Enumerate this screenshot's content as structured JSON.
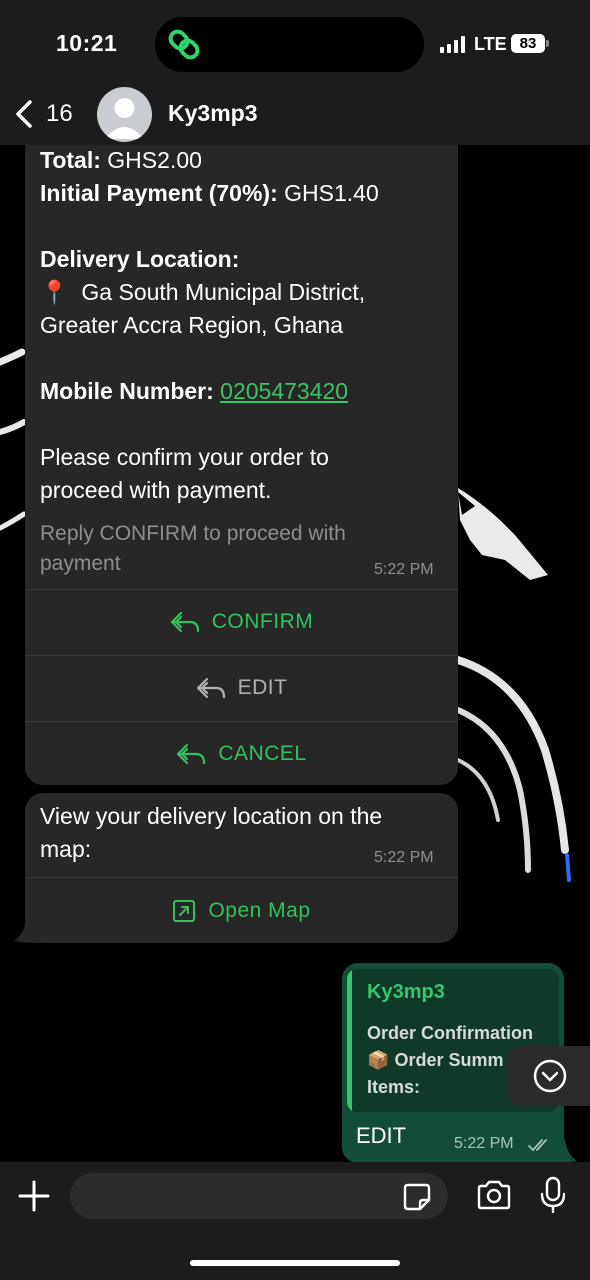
{
  "status": {
    "time": "10:21",
    "network": "LTE",
    "battery": "83"
  },
  "header": {
    "back_count": "16",
    "contact_name": "Ky3mp3"
  },
  "order_message": {
    "total_label": "Total:",
    "total_value": "GHS2.00",
    "initial_label": "Initial Payment (70%):",
    "initial_value": "GHS1.40",
    "delivery_label": "Delivery Location:",
    "pin": "📍",
    "location_line1": "Ga South Municipal District,",
    "location_line2": "Greater Accra Region, Ghana",
    "mobile_label": "Mobile Number:",
    "mobile_value": "0205473420",
    "confirm_line1": "Please confirm your order to",
    "confirm_line2": "proceed with payment.",
    "footer_line1": "Reply CONFIRM to proceed with",
    "footer_line2": "payment",
    "timestamp": "5:22 PM",
    "actions": [
      {
        "label": "CONFIRM",
        "color": "#33c05f"
      },
      {
        "label": "EDIT",
        "color": "#b0b1b0"
      },
      {
        "label": "CANCEL",
        "color": "#33c05f"
      }
    ]
  },
  "map_message": {
    "line1": "View your delivery location on the",
    "line2": "map:",
    "timestamp": "5:22 PM",
    "button_label": "Open Map"
  },
  "outgoing": {
    "quote_author": "Ky3mp3",
    "quote_line1": "Order Confirmation",
    "quote_emoji": "📦",
    "quote_line2": "Order Summ",
    "quote_line3": "Items:",
    "text": "EDIT",
    "timestamp": "5:22 PM"
  },
  "colors": {
    "accent": "#33c05f",
    "bubble_in": "#262726",
    "bubble_out": "#144d37"
  }
}
